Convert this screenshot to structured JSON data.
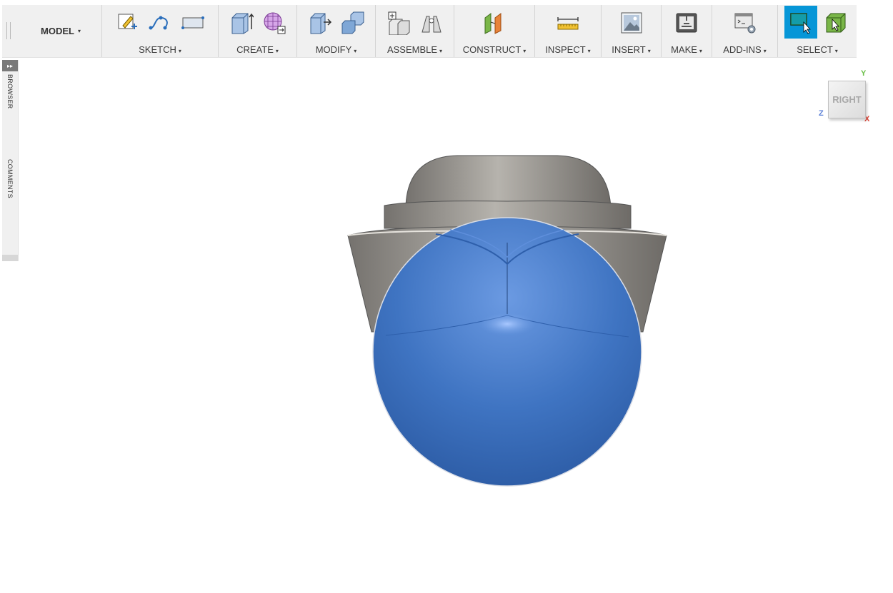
{
  "workspace": {
    "label": "MODEL",
    "caret": "▾"
  },
  "toolbar": {
    "groups": [
      {
        "label": "SKETCH",
        "icons": [
          "create-sketch-icon",
          "spline-icon",
          "rectangle-icon"
        ]
      },
      {
        "label": "CREATE",
        "icons": [
          "extrude-icon",
          "form-icon"
        ]
      },
      {
        "label": "MODIFY",
        "icons": [
          "press-pull-icon",
          "combine-icon"
        ]
      },
      {
        "label": "ASSEMBLE",
        "icons": [
          "new-component-icon",
          "joint-icon"
        ]
      },
      {
        "label": "CONSTRUCT",
        "icons": [
          "offset-plane-icon"
        ]
      },
      {
        "label": "INSPECT",
        "icons": [
          "measure-icon"
        ]
      },
      {
        "label": "INSERT",
        "icons": [
          "insert-image-icon"
        ]
      },
      {
        "label": "MAKE",
        "icons": [
          "3d-print-icon"
        ]
      },
      {
        "label": "ADD-INS",
        "icons": [
          "scripts-addins-icon"
        ]
      },
      {
        "label": "SELECT",
        "icons": [
          "window-select-icon",
          "select-body-icon"
        ]
      }
    ]
  },
  "side_panel": {
    "browser": "BROWSER",
    "comments": "COMMENTS",
    "expand": "▸▸"
  },
  "viewcube": {
    "face": "RIGHT",
    "axis_y": "Y",
    "axis_z": "Z",
    "axis_x": "X"
  },
  "colors": {
    "accent": "#0696d7",
    "body_grey": "#8c8a86",
    "sphere_blue": "#3f74c2"
  }
}
